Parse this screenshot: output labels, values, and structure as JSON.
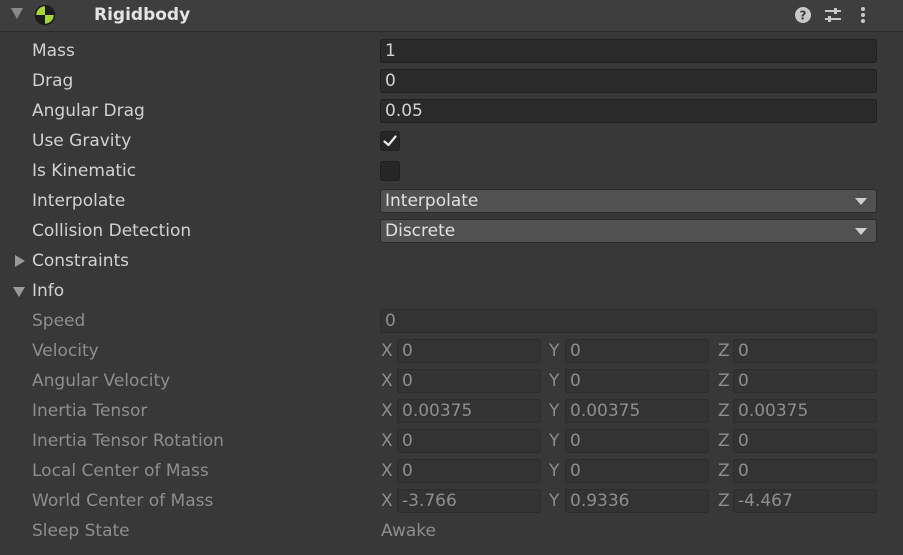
{
  "component": {
    "title": "Rigidbody",
    "colors": {
      "accent": "#a5d631",
      "panel": "#383838",
      "field": "#2a2a2a"
    },
    "icons": [
      "physics-icon",
      "help-icon",
      "presets-icon",
      "more-icon"
    ]
  },
  "properties": {
    "mass": {
      "label": "Mass",
      "value": "1"
    },
    "drag": {
      "label": "Drag",
      "value": "0"
    },
    "angular_drag": {
      "label": "Angular Drag",
      "value": "0.05"
    },
    "use_gravity": {
      "label": "Use Gravity",
      "checked": true
    },
    "is_kinematic": {
      "label": "Is Kinematic",
      "checked": false
    },
    "interpolate": {
      "label": "Interpolate",
      "value": "Interpolate"
    },
    "collision_detection": {
      "label": "Collision Detection",
      "value": "Discrete"
    }
  },
  "constraints": {
    "label": "Constraints",
    "expanded": false
  },
  "info": {
    "label": "Info",
    "expanded": true,
    "speed": {
      "label": "Speed",
      "value": "0"
    },
    "vectors": [
      {
        "label": "Velocity",
        "x": "0",
        "y": "0",
        "z": "0"
      },
      {
        "label": "Angular Velocity",
        "x": "0",
        "y": "0",
        "z": "0"
      },
      {
        "label": "Inertia Tensor",
        "x": "0.00375",
        "y": "0.00375",
        "z": "0.00375"
      },
      {
        "label": "Inertia Tensor Rotation",
        "x": "0",
        "y": "0",
        "z": "0"
      },
      {
        "label": "Local Center of Mass",
        "x": "0",
        "y": "0",
        "z": "0"
      },
      {
        "label": "World Center of Mass",
        "x": "-3.766",
        "y": "0.9336",
        "z": "-4.467"
      }
    ],
    "axis_labels": {
      "x": "X",
      "y": "Y",
      "z": "Z"
    },
    "sleep_state": {
      "label": "Sleep State",
      "value": "Awake"
    }
  }
}
